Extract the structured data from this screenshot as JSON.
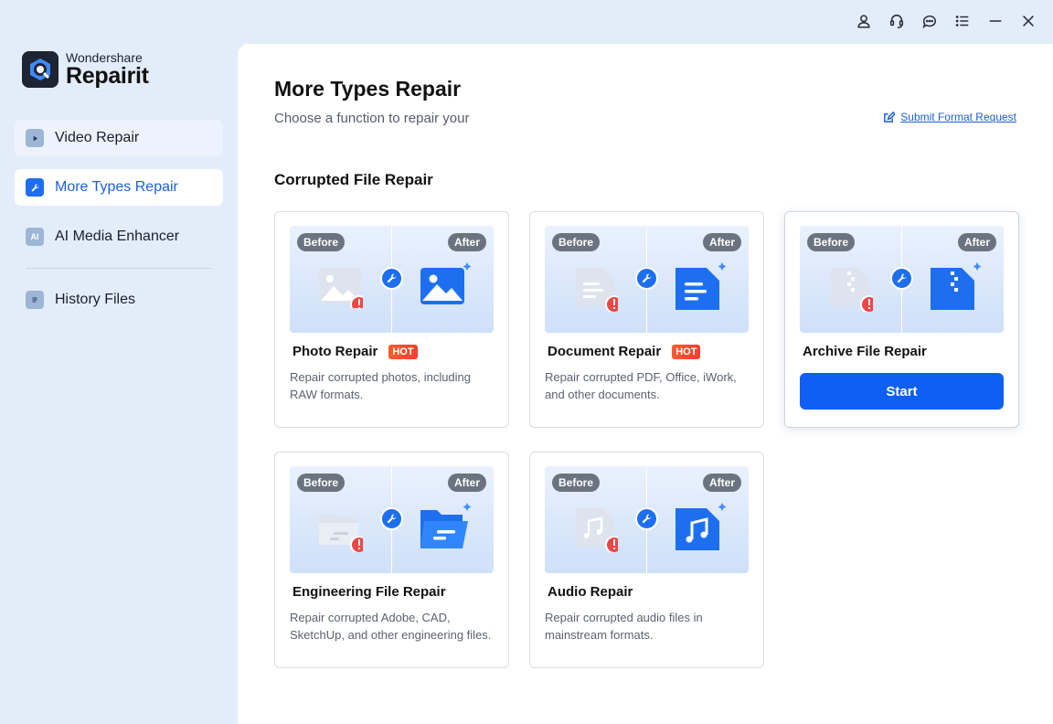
{
  "app": {
    "brand": "Wondershare",
    "name": "Repairit"
  },
  "window_controls": {
    "icons": [
      "account-icon",
      "support-icon",
      "feedback-icon",
      "menu-icon",
      "minimize-icon",
      "close-icon"
    ]
  },
  "sidebar": {
    "items": [
      {
        "label": "Video Repair",
        "icon": "video-icon"
      },
      {
        "label": "More Types Repair",
        "icon": "wrench-icon",
        "active": true
      },
      {
        "label": "AI Media Enhancer",
        "icon": "ai-icon",
        "icon_text": "AI"
      },
      {
        "label": "History Files",
        "icon": "history-icon"
      }
    ]
  },
  "main": {
    "title": "More Types Repair",
    "subtitle": "Choose a function to repair your",
    "submit_link": "Submit Format Request",
    "section_title": "Corrupted File Repair",
    "before_label": "Before",
    "after_label": "After",
    "hot_label": "HOT",
    "start_label": "Start",
    "cards": [
      {
        "title": "Photo Repair",
        "hot": true,
        "desc": "Repair corrupted photos, including RAW formats.",
        "icon": "photo-icon"
      },
      {
        "title": "Document Repair",
        "hot": true,
        "desc": "Repair corrupted PDF, Office, iWork, and other documents.",
        "icon": "document-icon"
      },
      {
        "title": "Archive File Repair",
        "hot": false,
        "desc": "",
        "icon": "archive-icon",
        "hovered": true
      },
      {
        "title": "Engineering File Repair",
        "hot": false,
        "desc": "Repair corrupted Adobe, CAD, SketchUp, and other engineering files.",
        "icon": "folder-icon"
      },
      {
        "title": "Audio Repair",
        "hot": false,
        "desc": "Repair corrupted audio files in mainstream formats.",
        "icon": "audio-icon"
      }
    ]
  },
  "colors": {
    "accent": "#0f5ff5",
    "active_nav_text": "#1d5fd6",
    "sidebar_bg": "#e3edfa",
    "hot_badge": "#ff3b30",
    "error_badge": "#f04545"
  }
}
